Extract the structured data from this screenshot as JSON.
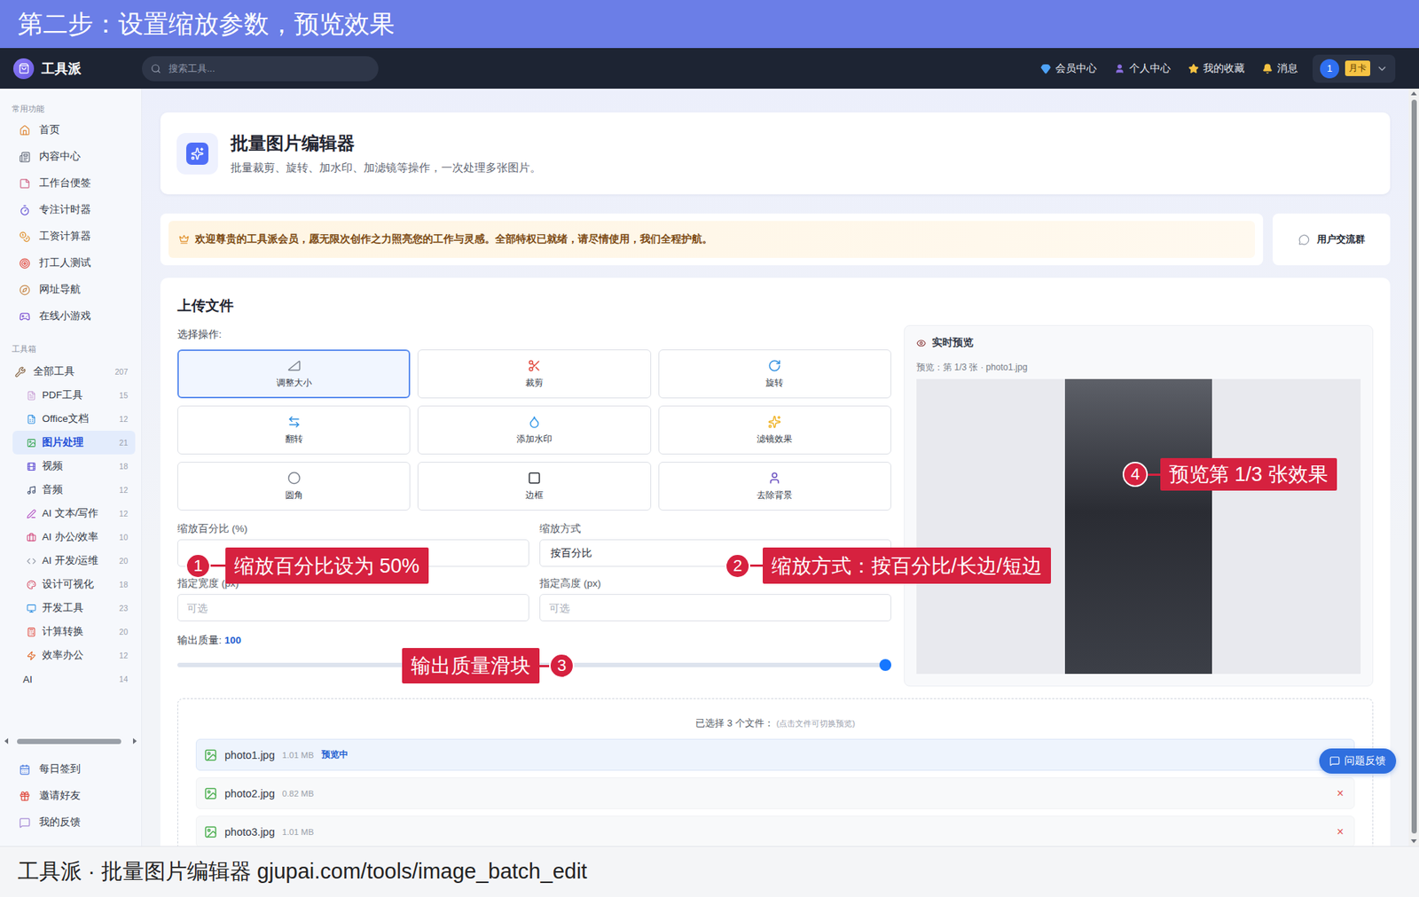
{
  "banner": {
    "title": "第二步：设置缩放参数，预览效果"
  },
  "nav": {
    "logo": "工具派",
    "search_placeholder": "搜索工具...",
    "links": [
      {
        "label": "会员中心"
      },
      {
        "label": "个人中心"
      },
      {
        "label": "我的收藏"
      },
      {
        "label": "消息"
      }
    ],
    "avatar": "1",
    "badge": "月卡"
  },
  "sidebar": {
    "sections": [
      {
        "title": "常用功能",
        "items": [
          {
            "label": "首页",
            "kind": "plain",
            "selected": false
          },
          {
            "label": "内容中心",
            "kind": "plain",
            "selected": false
          },
          {
            "label": "工作台便签",
            "kind": "plain",
            "selected": false
          },
          {
            "label": "专注计时器",
            "kind": "plain",
            "selected": false
          },
          {
            "label": "工资计算器",
            "kind": "plain",
            "selected": false
          },
          {
            "label": "打工人测试",
            "kind": "plain",
            "selected": false
          },
          {
            "label": "网址导航",
            "kind": "plain",
            "selected": false
          },
          {
            "label": "在线小游戏",
            "kind": "plain",
            "selected": false
          }
        ]
      },
      {
        "title": "工具箱",
        "items": [
          {
            "label": "全部工具",
            "count": "207",
            "kind": "group",
            "selected": false
          },
          {
            "label": "PDF工具",
            "count": "15",
            "kind": "child",
            "selected": false
          },
          {
            "label": "Office文档",
            "count": "12",
            "kind": "child",
            "selected": false
          },
          {
            "label": "图片处理",
            "count": "21",
            "kind": "child",
            "selected": true
          },
          {
            "label": "视频",
            "count": "18",
            "kind": "child",
            "selected": false
          },
          {
            "label": "音频",
            "count": "12",
            "kind": "child",
            "selected": false
          },
          {
            "label": "AI 文本/写作",
            "count": "12",
            "kind": "child",
            "selected": false
          },
          {
            "label": "AI 办公/效率",
            "count": "10",
            "kind": "child",
            "selected": false
          },
          {
            "label": "AI 开发/运维",
            "count": "20",
            "kind": "child",
            "selected": false
          },
          {
            "label": "设计可视化",
            "count": "18",
            "kind": "child",
            "selected": false
          },
          {
            "label": "开发工具",
            "count": "23",
            "kind": "child",
            "selected": false
          },
          {
            "label": "计算转换",
            "count": "20",
            "kind": "child",
            "selected": false
          },
          {
            "label": "效率办公",
            "count": "12",
            "kind": "child",
            "selected": false
          },
          {
            "label": "AI",
            "count": "14",
            "kind": "bare",
            "selected": false
          }
        ]
      }
    ],
    "footer": [
      {
        "label": "每日签到"
      },
      {
        "label": "邀请好友"
      },
      {
        "label": "我的反馈"
      }
    ]
  },
  "header": {
    "title": "批量图片编辑器",
    "subtitle": "批量裁剪、旋转、加水印、加滤镜等操作，一次处理多张图片。"
  },
  "notice": {
    "text": "欢迎尊贵的工具派会员，愿无限次创作之力照亮您的工作与灵感。全部特权已就绪，请尽情使用，我们全程护航。",
    "chat": "用户交流群"
  },
  "upload": {
    "title": "上传文件",
    "ops_label": "选择操作:",
    "ops": [
      {
        "label": "调整大小",
        "selected": true
      },
      {
        "label": "裁剪",
        "selected": false
      },
      {
        "label": "旋转",
        "selected": false
      },
      {
        "label": "翻转",
        "selected": false
      },
      {
        "label": "添加水印",
        "selected": false
      },
      {
        "label": "滤镜效果",
        "selected": false
      },
      {
        "label": "圆角",
        "selected": false
      },
      {
        "label": "边框",
        "selected": false
      },
      {
        "label": "去除背景",
        "selected": false
      }
    ],
    "fields": [
      {
        "label": "缩放百分比 (%)",
        "kind": "input"
      },
      {
        "label": "缩放方式",
        "kind": "select",
        "value": "按百分比"
      },
      {
        "label": "指定宽度 (px)",
        "kind": "input",
        "placeholder": "可选"
      },
      {
        "label": "指定高度 (px)",
        "kind": "input",
        "placeholder": "可选"
      }
    ],
    "quality": {
      "label": "输出质量:",
      "value": "100",
      "level": 1
    },
    "preview": {
      "title": "实时预览",
      "caption": "预览：第 1/3 张 · photo1.jpg"
    },
    "files": {
      "summary": "已选择 3 个文件：",
      "hint": "(点击文件可切换预览)",
      "items": [
        {
          "name": "photo1.jpg",
          "size": "1.01 MB",
          "tag": "预览中",
          "selected": true
        },
        {
          "name": "photo2.jpg",
          "size": "0.82 MB",
          "remove": "×",
          "selected": false
        },
        {
          "name": "photo3.jpg",
          "size": "1.01 MB",
          "remove": "×",
          "selected": false
        }
      ]
    }
  },
  "feedback": "问题反馈",
  "annotations": [
    {
      "number": "1",
      "text": "缩放百分比设为 50%"
    },
    {
      "number": "2",
      "text": "缩放方式：按百分比/长边/短边"
    },
    {
      "number": "3",
      "text": "输出质量滑块"
    },
    {
      "number": "4",
      "text": "预览第 1/3 张效果"
    }
  ],
  "caption": "工具派 · 批量图片编辑器 gjupai.com/tools/image_batch_edit"
}
